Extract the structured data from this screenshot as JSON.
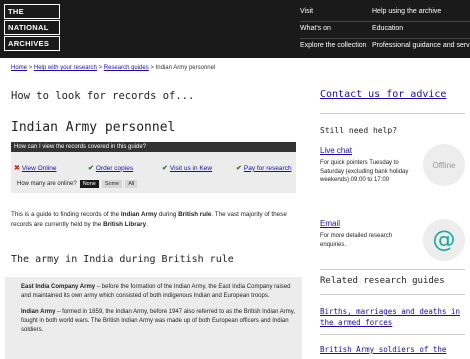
{
  "header": {
    "logo": [
      "THE",
      "NATIONAL",
      "ARCHIVES"
    ],
    "nav_col1": [
      "Visit",
      "What's on",
      "Explore the collection"
    ],
    "nav_col2": [
      "Help using the archive",
      "Education",
      "Professional guidance and services"
    ]
  },
  "breadcrumb": {
    "home": "Home",
    "sep1": " > ",
    "help": "Help with your research",
    "sep2": " > ",
    "guides": "Research guides",
    "sep3": " > ",
    "current": "Indian Army personnel"
  },
  "main": {
    "kicker": "How to look for records of...",
    "title": "Indian Army personnel",
    "question_bar": "How can I view the records covered in this guide?",
    "options": [
      {
        "label": "View Online",
        "mark": "✖"
      },
      {
        "label": "Order copies",
        "mark": "✔"
      },
      {
        "label": "Visit us in Kew",
        "mark": "✔"
      },
      {
        "label": "Pay for research",
        "mark": "✔"
      }
    ],
    "online_label": "How many are online?",
    "online_pills": [
      "None",
      "Some",
      "All"
    ],
    "intro_pre": "This is a guide to finding records of the ",
    "intro_b1": "Indian Army",
    "intro_mid": " during ",
    "intro_b2": "British rule",
    "intro_post": ". The vast majority of these records are currently held by the ",
    "intro_b3": "British Library",
    "intro_end": ".",
    "section_title": "The army in India during British rule",
    "eic_bold": "East India Company Army",
    "eic_text": " – before the formation of the Indian Army, the East India Company raised and maintained its own army which consisted of both indigenous Indian and European troops.",
    "ia_bold": "Indian Army",
    "ia_text": " – formed in 1859, the Indian Army, before 1947 also referred to as the British Indian Army, fought in both world wars. The British Indian Army was made up of both European officers and Indian soldiers."
  },
  "sidebar": {
    "contact": "Contact us for advice",
    "still": "Still need help?",
    "live_chat": "Live chat",
    "live_chat_text": "For quick pointers Tuesday to Saturday (excluding bank holiday weekends) 09:00 to 17:00",
    "offline": "Offline",
    "email": "Email",
    "email_text": "For more detailed research enquiries.",
    "email_symbol": "@",
    "related": "Related research guides",
    "related_links": [
      "Births, marriages and deaths in the armed forces",
      "British Army soldiers of the"
    ]
  }
}
